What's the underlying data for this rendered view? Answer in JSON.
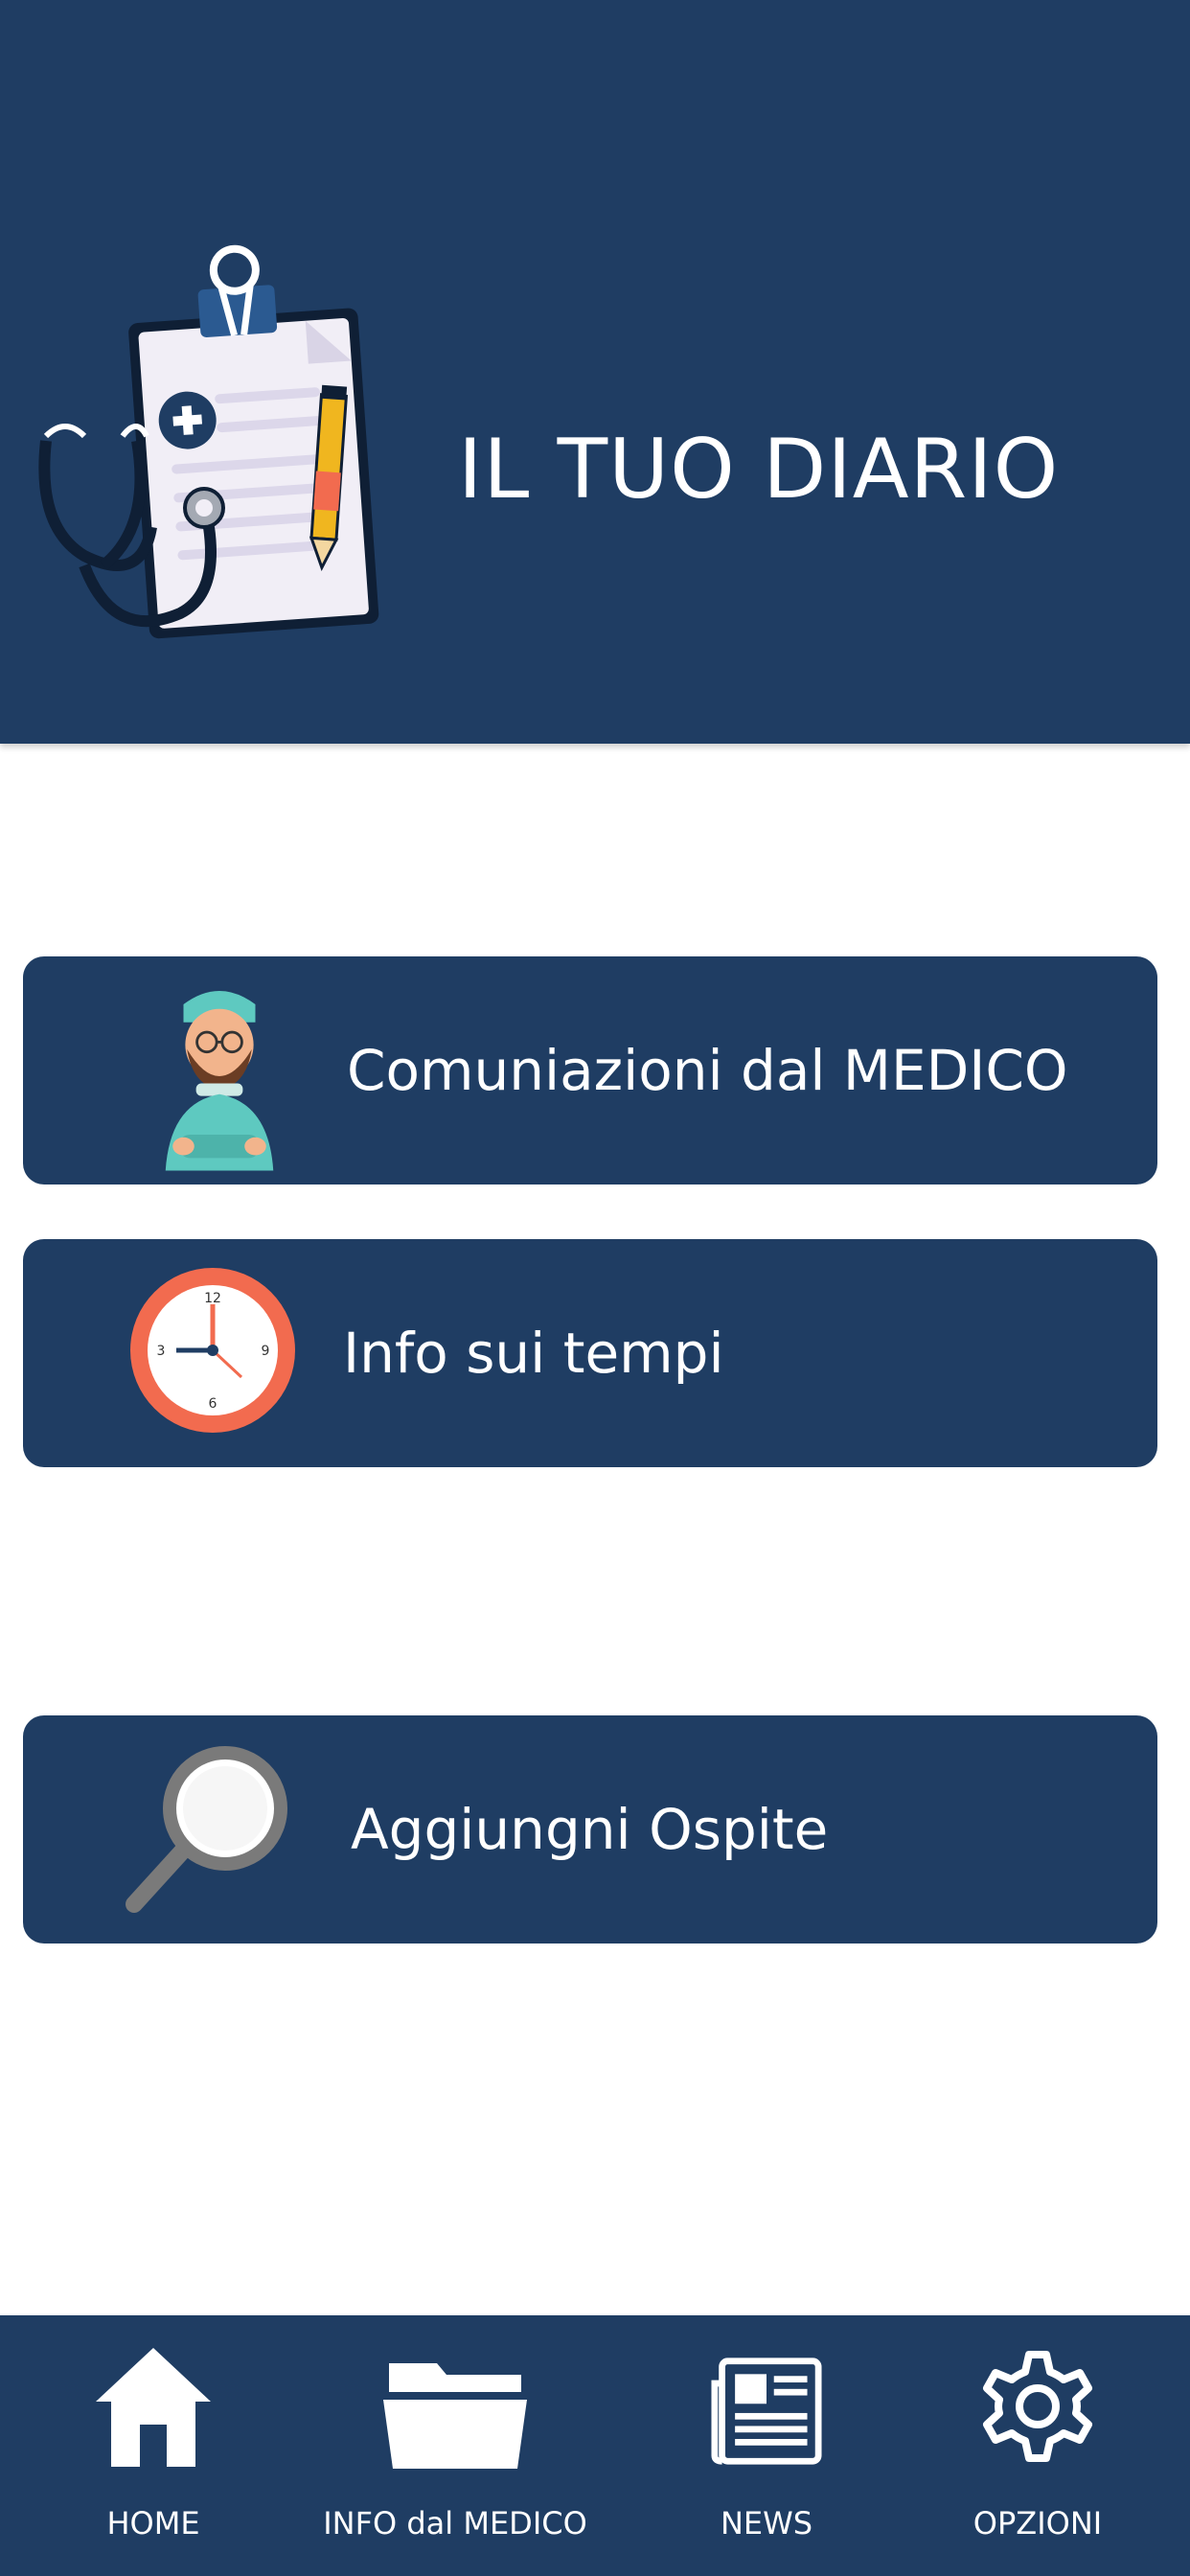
{
  "header": {
    "title": "IL TUO DIARIO",
    "background_color": "#1f3d63",
    "illustration": "clipboard-stethoscope-icon"
  },
  "menu": [
    {
      "label": "Comuniazioni dal MEDICO",
      "icon": "doctor-icon"
    },
    {
      "label": "Info sui tempi",
      "icon": "clock-icon"
    },
    {
      "label": "Aggiungni Ospite",
      "icon": "magnifier-icon"
    }
  ],
  "bottom_nav": {
    "items": [
      {
        "label": "HOME",
        "icon": "home-icon"
      },
      {
        "label": "INFO dal MEDICO",
        "icon": "folder-icon"
      },
      {
        "label": "NEWS",
        "icon": "newspaper-icon"
      },
      {
        "label": "OPZIONI",
        "icon": "gear-icon"
      }
    ]
  },
  "colors": {
    "primary": "#1f3d63",
    "accent_clock": "#f26b4f",
    "doctor_scrubs": "#5ec9c0"
  }
}
